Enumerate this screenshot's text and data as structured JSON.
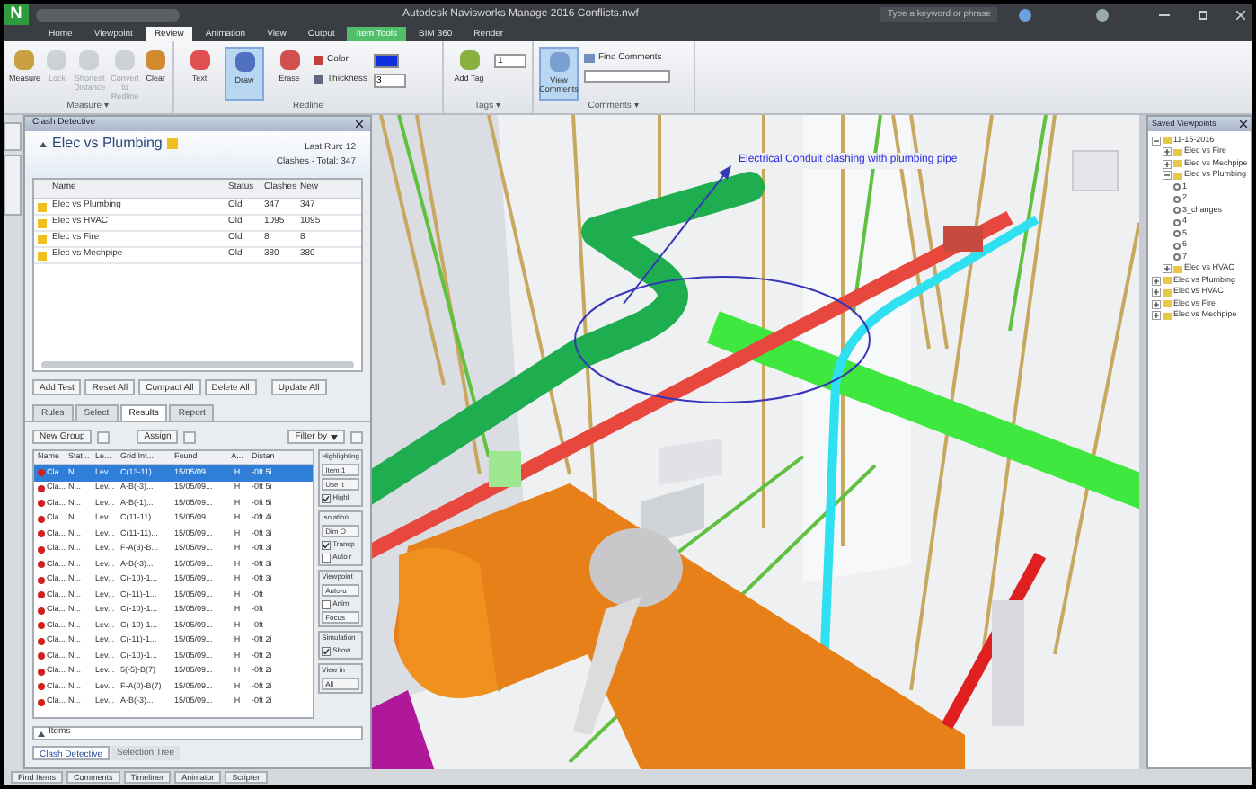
{
  "window": {
    "app_letter": "N",
    "title": "Autodesk Navisworks Manage 2016   Conflicts.nwf",
    "search": {
      "placeholder": "Type a keyword or phrase"
    }
  },
  "ribbon_tabs": [
    {
      "label": "Home",
      "selected": false,
      "kind": "normal"
    },
    {
      "label": "Viewpoint",
      "selected": false,
      "kind": "normal"
    },
    {
      "label": "Review",
      "selected": true,
      "kind": "normal"
    },
    {
      "label": "Animation",
      "selected": false,
      "kind": "normal"
    },
    {
      "label": "View",
      "selected": false,
      "kind": "normal"
    },
    {
      "label": "Output",
      "selected": false,
      "kind": "normal"
    },
    {
      "label": "Item Tools",
      "selected": false,
      "kind": "contextual"
    },
    {
      "label": "BIM 360",
      "selected": false,
      "kind": "normal"
    },
    {
      "label": "Render",
      "selected": false,
      "kind": "normal"
    }
  ],
  "ribbon_groups": [
    {
      "label": "Measure ▾",
      "buttons": [
        {
          "label": "Measure",
          "disabled": false,
          "selected": false
        },
        {
          "label": "Lock",
          "disabled": true,
          "selected": false
        },
        {
          "label": "Shortest Distance",
          "disabled": true,
          "selected": false
        },
        {
          "label": "Convert to Redline",
          "disabled": true,
          "selected": false
        },
        {
          "label": "Clear",
          "disabled": false,
          "selected": false
        }
      ]
    },
    {
      "label": "Redline",
      "buttons": [
        {
          "label": "Text",
          "disabled": false,
          "selected": false
        },
        {
          "label": "Draw",
          "disabled": false,
          "selected": true
        },
        {
          "label": "Erase",
          "disabled": false,
          "selected": false
        }
      ],
      "color_label": "Color",
      "thickness_label": "Thickness",
      "thickness": "3"
    },
    {
      "label": "Tags ▾",
      "buttons": [
        {
          "label": "Add Tag",
          "disabled": false,
          "selected": false
        }
      ],
      "tag_value": "1"
    },
    {
      "label": "Comments ▾",
      "buttons": [
        {
          "label": "View Comments",
          "disabled": false,
          "selected": true
        }
      ],
      "find_label": "Find Comments"
    }
  ],
  "clash_detective": {
    "title": "Clash Detective",
    "test_name": "Elec vs Plumbing",
    "last_run": "Last Run: 12",
    "summary": "Clashes - Total: 347",
    "test_columns": [
      "Name",
      "Status",
      "Clashes",
      "New"
    ],
    "tests": [
      {
        "name": "Elec vs Plumbing",
        "status": "Old",
        "clashes": "347",
        "new": "347",
        "selected": false
      },
      {
        "name": "Elec vs HVAC",
        "status": "Old",
        "clashes": "1095",
        "new": "1095",
        "selected": false
      },
      {
        "name": "Elec vs Fire",
        "status": "Old",
        "clashes": "8",
        "new": "8",
        "selected": false
      },
      {
        "name": "Elec vs Mechpipe",
        "status": "Old",
        "clashes": "380",
        "new": "380",
        "selected": false
      }
    ],
    "test_buttons": [
      "Add Test",
      "Reset All",
      "Compact All",
      "Delete All",
      "Update All"
    ],
    "tabs": [
      {
        "label": "Rules",
        "selected": false
      },
      {
        "label": "Select",
        "selected": false
      },
      {
        "label": "Results",
        "selected": true
      },
      {
        "label": "Report",
        "selected": false
      }
    ],
    "toolbar": {
      "new_group": "New Group",
      "assign": "Assign",
      "filter": "Filter by"
    },
    "result_columns": [
      "Name",
      "Stat...",
      "Le...",
      "Grid Int...",
      "Found",
      "A...",
      "Distan"
    ],
    "results": [
      {
        "name": "Cla...",
        "status": "N...",
        "level": "Lev...",
        "grid": "C(13-11)...",
        "found": "15/05/09...",
        "axis": "H",
        "distance": "-0ft 5i",
        "selected": true
      },
      {
        "name": "Cla...",
        "status": "N...",
        "level": "Lev...",
        "grid": "A-B(-3)...",
        "found": "15/05/09...",
        "axis": "H",
        "distance": "-0ft 5i",
        "selected": false
      },
      {
        "name": "Cla...",
        "status": "N...",
        "level": "Lev...",
        "grid": "A-B(-1)...",
        "found": "15/05/09...",
        "axis": "H",
        "distance": "-0ft 5i",
        "selected": false
      },
      {
        "name": "Cla...",
        "status": "N...",
        "level": "Lev...",
        "grid": "C(11-11)...",
        "found": "15/05/09...",
        "axis": "H",
        "distance": "-0ft 4i",
        "selected": false
      },
      {
        "name": "Cla...",
        "status": "N...",
        "level": "Lev...",
        "grid": "C(11-11)...",
        "found": "15/05/09...",
        "axis": "H",
        "distance": "-0ft 3i",
        "selected": false
      },
      {
        "name": "Cla...",
        "status": "N...",
        "level": "Lev...",
        "grid": "F-A(3)-B...",
        "found": "15/05/09...",
        "axis": "H",
        "distance": "-0ft 3i",
        "selected": false
      },
      {
        "name": "Cla...",
        "status": "N...",
        "level": "Lev...",
        "grid": "A-B(-3)...",
        "found": "15/05/09...",
        "axis": "H",
        "distance": "-0ft 3i",
        "selected": false
      },
      {
        "name": "Cla...",
        "status": "N...",
        "level": "Lev...",
        "grid": "C(-10)-1...",
        "found": "15/05/09...",
        "axis": "H",
        "distance": "-0ft 3i",
        "selected": false
      },
      {
        "name": "Cla...",
        "status": "N...",
        "level": "Lev...",
        "grid": "C(-11)-1...",
        "found": "15/05/09...",
        "axis": "H",
        "distance": "-0ft",
        "selected": false
      },
      {
        "name": "Cla...",
        "status": "N...",
        "level": "Lev...",
        "grid": "C(-10)-1...",
        "found": "15/05/09...",
        "axis": "H",
        "distance": "-0ft",
        "selected": false
      },
      {
        "name": "Cla...",
        "status": "N...",
        "level": "Lev...",
        "grid": "C(-10)-1...",
        "found": "15/05/09...",
        "axis": "H",
        "distance": "-0ft",
        "selected": false
      },
      {
        "name": "Cla...",
        "status": "N...",
        "level": "Lev...",
        "grid": "C(-11)-1...",
        "found": "15/05/09...",
        "axis": "H",
        "distance": "-0ft 2i",
        "selected": false
      },
      {
        "name": "Cla...",
        "status": "N...",
        "level": "Lev...",
        "grid": "C(-10)-1...",
        "found": "15/05/09...",
        "axis": "H",
        "distance": "-0ft 2i",
        "selected": false
      },
      {
        "name": "Cla...",
        "status": "N...",
        "level": "Lev...",
        "grid": "5(-5)-B(7)",
        "found": "15/05/09...",
        "axis": "H",
        "distance": "-0ft 2i",
        "selected": false
      },
      {
        "name": "Cla...",
        "status": "N...",
        "level": "Lev...",
        "grid": "F-A(0)-B(7)",
        "found": "15/05/09...",
        "axis": "H",
        "distance": "-0ft 2i",
        "selected": false
      },
      {
        "name": "Cla...",
        "status": "N...",
        "level": "Lev...",
        "grid": "A-B(-3)...",
        "found": "15/05/09...",
        "axis": "H",
        "distance": "-0ft 2i",
        "selected": false
      }
    ],
    "side_sections": [
      {
        "title": "Highlighting",
        "items": [
          {
            "label": "Item 1",
            "kind": "button"
          },
          {
            "label": "Use it",
            "kind": "button"
          },
          {
            "label": "Highl",
            "kind": "checkbox",
            "checked": true
          }
        ]
      },
      {
        "title": "Isolation",
        "items": [
          {
            "label": "Dim O",
            "kind": "button"
          },
          {
            "label": "Transp",
            "kind": "checkbox",
            "checked": true
          },
          {
            "label": "Auto r",
            "kind": "checkbox",
            "checked": false
          }
        ]
      },
      {
        "title": "Viewpoint",
        "items": [
          {
            "label": "Auto-u",
            "kind": "button"
          },
          {
            "label": "Anim",
            "kind": "checkbox",
            "checked": false
          },
          {
            "label": "Focus",
            "kind": "button"
          }
        ]
      },
      {
        "title": "Simulation",
        "items": [
          {
            "label": "Show",
            "kind": "checkbox",
            "checked": true
          }
        ]
      },
      {
        "title": "View in",
        "items": [
          {
            "label": "All",
            "kind": "button"
          }
        ]
      }
    ],
    "items_label": "Items",
    "bottom_tabs": [
      {
        "label": "Clash Detective",
        "selected": true
      },
      {
        "label": "Selection Tree",
        "selected": false
      }
    ]
  },
  "viewport": {
    "annotation": "Electrical Conduit clashing with plumbing pipe"
  },
  "saved_viewpoints": {
    "title": "Saved Viewpoints",
    "tree": [
      {
        "label": "11-15-2016",
        "expanded": true,
        "children": [
          {
            "label": "Elec vs Fire",
            "expanded": false
          },
          {
            "label": "Elec vs Mechpipe",
            "expanded": false
          },
          {
            "label": "Elec vs Plumbing",
            "expanded": true,
            "children": [
              {
                "label": "1"
              },
              {
                "label": "2"
              },
              {
                "label": "3_changes"
              },
              {
                "label": "4"
              },
              {
                "label": "5"
              },
              {
                "label": "6"
              },
              {
                "label": "7"
              }
            ]
          },
          {
            "label": "Elec vs HVAC",
            "expanded": false
          }
        ]
      },
      {
        "label": "Elec vs Plumbing",
        "expanded": false
      },
      {
        "label": "Elec vs HVAC",
        "expanded": false
      },
      {
        "label": "Elec vs Fire",
        "expanded": false
      },
      {
        "label": "Elec vs Mechpipe",
        "expanded": false
      }
    ]
  },
  "status_bar": [
    "Find Items",
    "Comments",
    "Timeliner",
    "Animator",
    "Scripter"
  ]
}
